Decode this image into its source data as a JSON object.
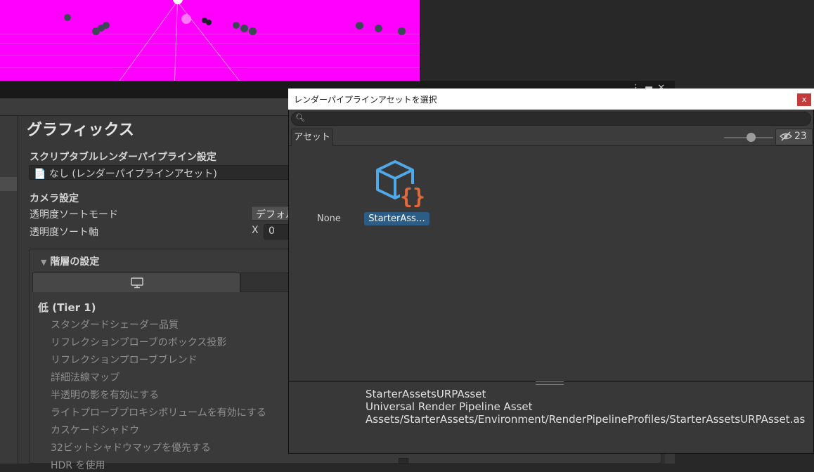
{
  "inspector": {
    "title": "グラフィックス",
    "srp_label": "スクリプタブルレンダーパイプライン設定",
    "srp_value": "なし (レンダーパイプラインアセット)",
    "camera_section": "カメラ設定",
    "sort_mode_label": "透明度ソートモード",
    "sort_mode_value": "デフォル",
    "sort_axis_label": "透明度ソート軸",
    "sort_axis_x_label": "X",
    "sort_axis_x_value": "0",
    "tier_foldout": "階層の設定",
    "tier_heading": "低 (Tier 1)",
    "tier_items": [
      "スタンダードシェーダー品質",
      "リフレクションプローブのボックス投影",
      "リフレクションプローブブレンド",
      "詳細法線マップ",
      "半透明の影を有効にする",
      "ライトプローブプロキシボリュームを有効にする",
      "カスケードシャドウ",
      "32ビットシャドウマップを優先する",
      "HDR を使用"
    ]
  },
  "picker": {
    "title": "レンダーパイプラインアセットを選択",
    "close_label": "x",
    "tab_assets": "アセット",
    "hidden_count": "23",
    "none_label": "None",
    "asset_label": "StarterAss…",
    "details": {
      "name": "StarterAssetsURPAsset",
      "type": "Universal Render Pipeline Asset",
      "path": "Assets/StarterAssets/Environment/RenderPipelineProfiles/StarterAssetsURPAsset.asset"
    }
  },
  "icons": {
    "search": "search-icon",
    "eye": "eye-hidden-icon",
    "monitor": "monitor-icon",
    "file": "file-icon",
    "foldout": "triangle-down-icon",
    "asset": "script-asset-icon"
  },
  "colors": {
    "scene_background": "#ff00ff",
    "selection": "#2c5d87",
    "close_button": "#c43b3b",
    "asset_cube": "#4fa9e8",
    "asset_braces": "#e06a3b"
  }
}
